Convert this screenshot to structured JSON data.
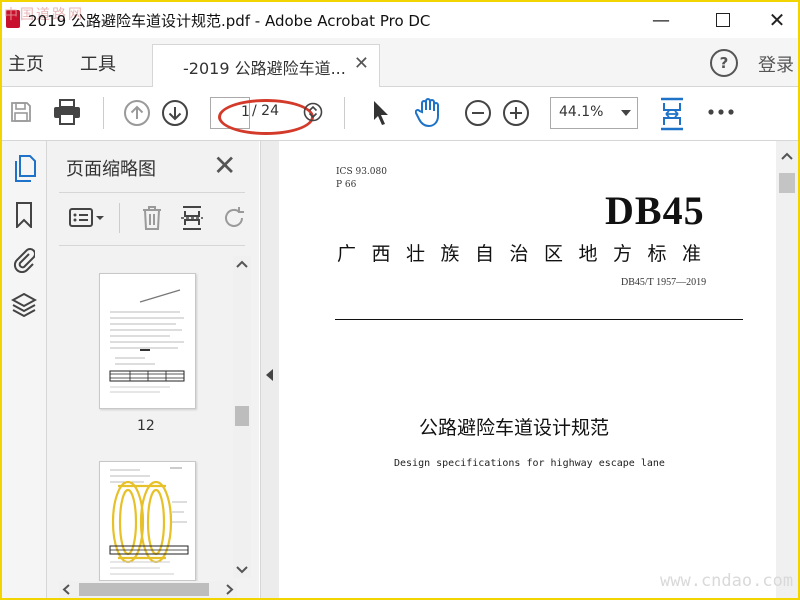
{
  "window": {
    "title": "2019 公路避险车道设计规范.pdf - Adobe Acrobat Pro DC",
    "watermark_top": "中国道路网",
    "minimize_icon": "minimize-icon",
    "maximize_icon": "maximize-icon",
    "close_icon": "close-icon"
  },
  "menu": {
    "home": "主页",
    "tools": "工具",
    "doc_tab": "-2019 公路避险车道...",
    "help": "?",
    "login": "登录"
  },
  "toolbar": {
    "page_current": "1",
    "page_total": "/ 24",
    "zoom": "44.1%"
  },
  "thumbnails_panel": {
    "title": "页面缩略图",
    "page_number": "12"
  },
  "document": {
    "ics": "ICS  93.080",
    "p": "P  66",
    "code_big": "DB45",
    "region": "广西壮族自治区地方标准",
    "standard_no": "DB45/T 1957—2019",
    "title_cn": "公路避险车道设计规范",
    "title_en": "Design specifications for highway escape lane"
  },
  "site_watermark": "www.cndao.com",
  "colors": {
    "accent_blue": "#1e73c8",
    "annotation_red": "#d43a2a",
    "frame_yellow": "#f2d400"
  }
}
